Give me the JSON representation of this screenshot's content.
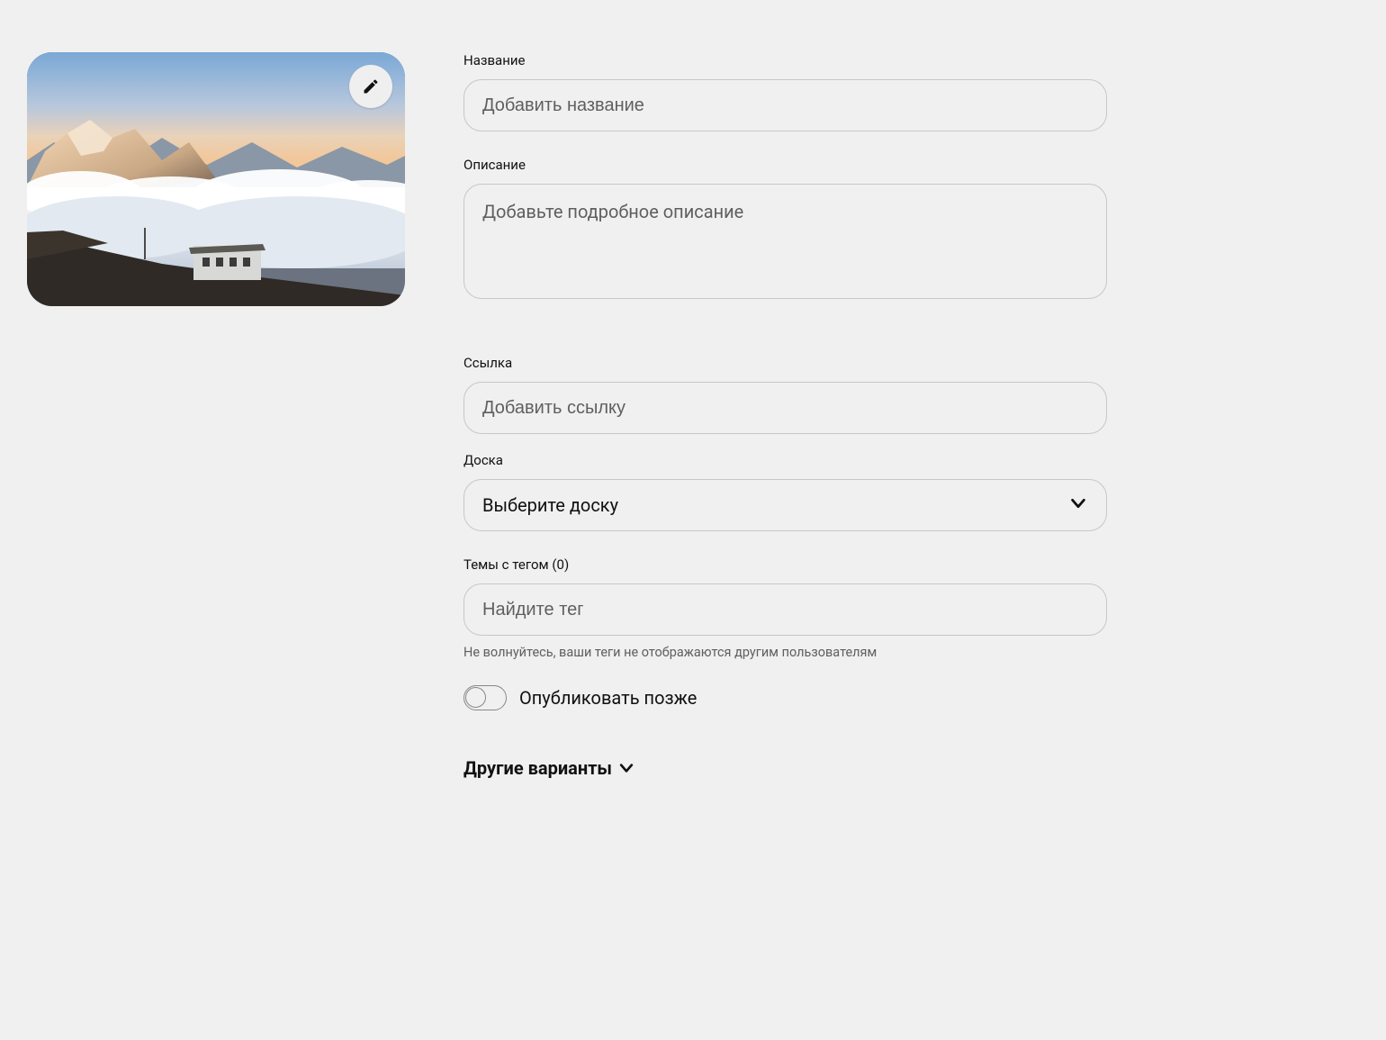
{
  "form": {
    "title": {
      "label": "Название",
      "placeholder": "Добавить название",
      "value": ""
    },
    "description": {
      "label": "Описание",
      "placeholder": "Добавьте подробное описание",
      "value": ""
    },
    "link": {
      "label": "Ссылка",
      "placeholder": "Добавить ссылку",
      "value": ""
    },
    "board": {
      "label": "Доска",
      "selected": "Выберите доску"
    },
    "tags": {
      "label": "Темы с тегом (0)",
      "placeholder": "Найдите тег",
      "hint": "Не волнуйтесь, ваши теги не отображаются другим пользователям",
      "value": ""
    },
    "publish_later": {
      "label": "Опубликовать позже",
      "enabled": false
    },
    "more_options": "Другие варианты"
  },
  "icons": {
    "edit": "pencil-icon",
    "chevron_down": "chevron-down-icon"
  }
}
